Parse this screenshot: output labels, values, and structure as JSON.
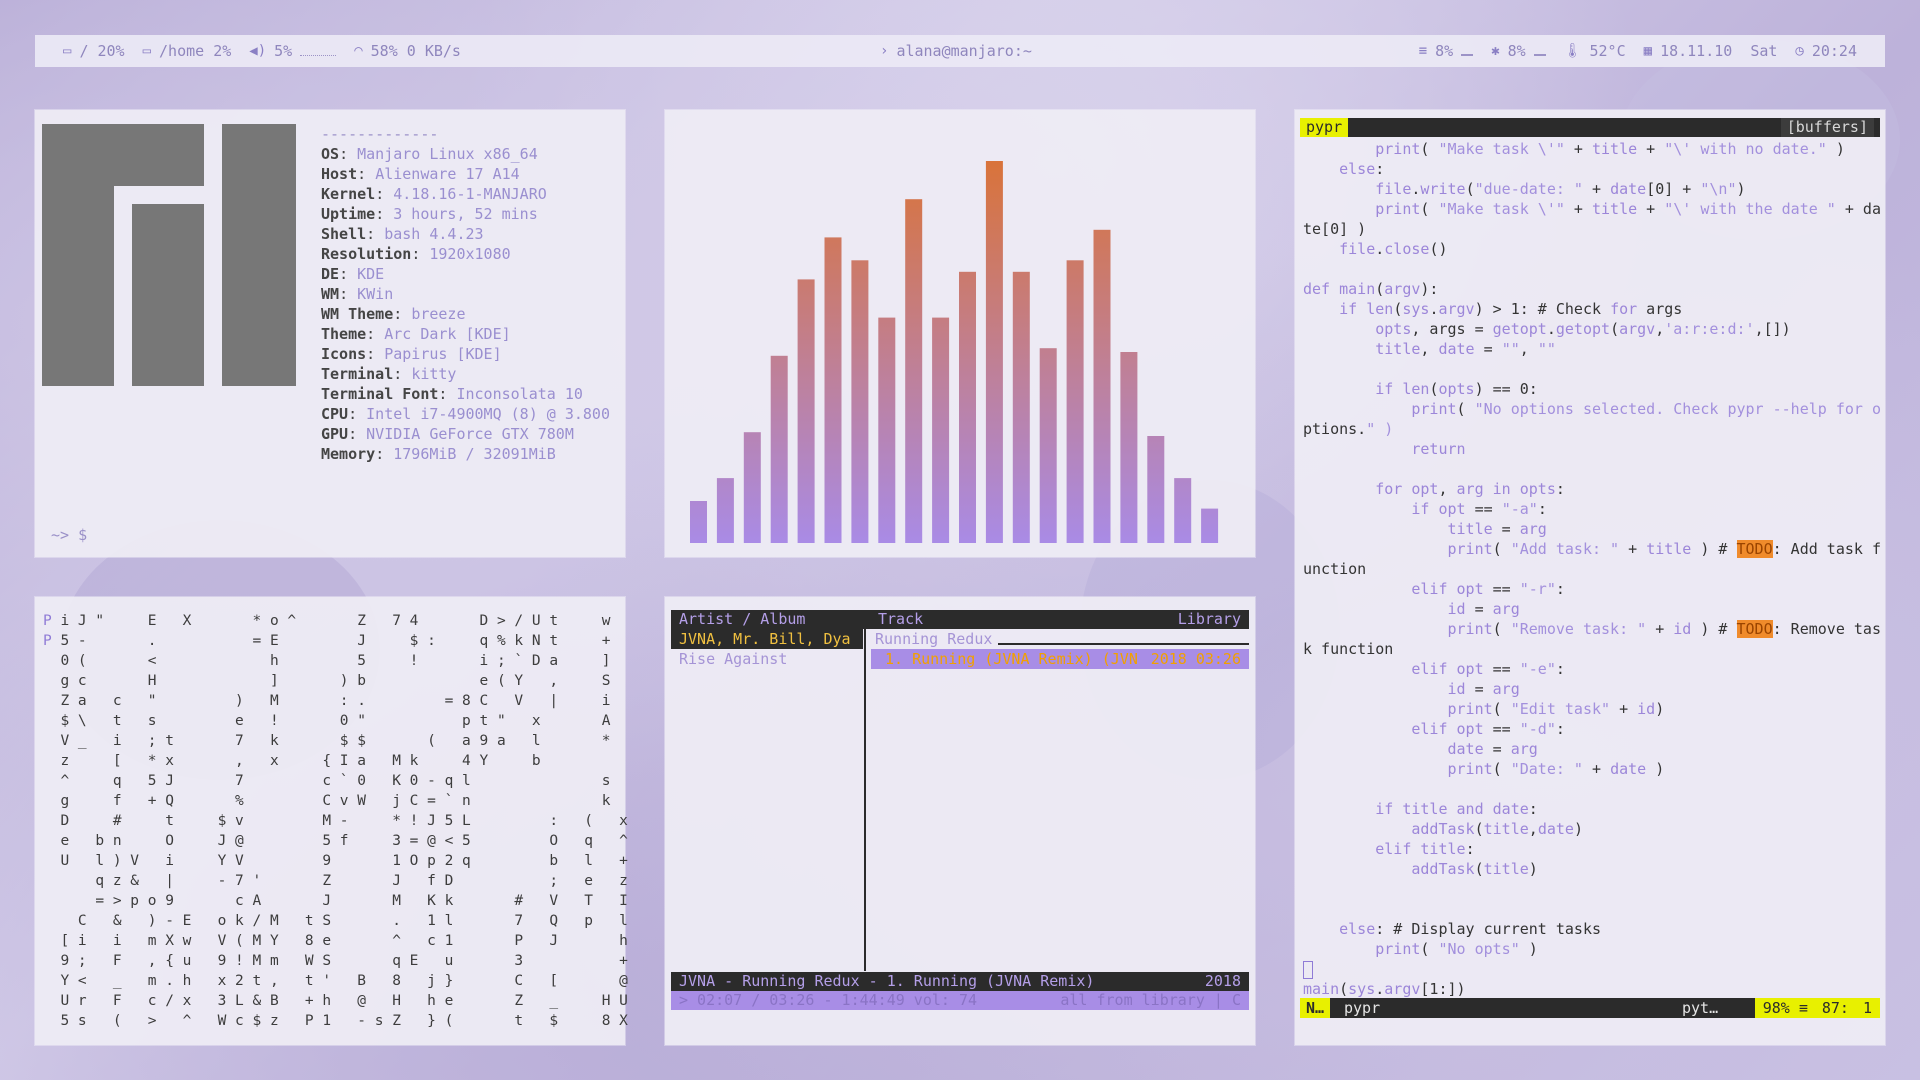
{
  "topbar": {
    "disk_root": "/ 20%",
    "disk_home": "/home 2%",
    "volume": "5%",
    "wifi": "58% 0 KB/s",
    "title": "alana@manjaro:~",
    "cpu": "8%",
    "mem": "8%",
    "temp": "52°C",
    "date": "18.11.10",
    "day": "Sat",
    "time": "20:24"
  },
  "neofetch": {
    "separator": "-------------",
    "fields": [
      {
        "k": "OS",
        "v": "Manjaro Linux x86_64"
      },
      {
        "k": "Host",
        "v": "Alienware 17 A14"
      },
      {
        "k": "Kernel",
        "v": "4.18.16-1-MANJARO"
      },
      {
        "k": "Uptime",
        "v": "3 hours, 52 mins"
      },
      {
        "k": "Shell",
        "v": "bash 4.4.23"
      },
      {
        "k": "Resolution",
        "v": "1920x1080"
      },
      {
        "k": "DE",
        "v": "KDE"
      },
      {
        "k": "WM",
        "v": "KWin"
      },
      {
        "k": "WM Theme",
        "v": "breeze"
      },
      {
        "k": "Theme",
        "v": "Arc Dark [KDE]"
      },
      {
        "k": "Icons",
        "v": "Papirus [KDE]"
      },
      {
        "k": "Terminal",
        "v": "kitty"
      },
      {
        "k": "Terminal Font",
        "v": "Inconsolata 10"
      },
      {
        "k": "CPU",
        "v": "Intel i7-4900MQ (8) @ 3.800"
      },
      {
        "k": "GPU",
        "v": "NVIDIA GeForce GTX 780M"
      },
      {
        "k": "Memory",
        "v": "1796MiB / 32091MiB"
      }
    ],
    "prompt": "~> $"
  },
  "visualizer": {
    "levels": [
      0.11,
      0.17,
      0.29,
      0.49,
      0.69,
      0.8,
      0.74,
      0.59,
      0.9,
      0.59,
      0.71,
      1.0,
      0.71,
      0.51,
      0.74,
      0.82,
      0.5,
      0.28,
      0.17,
      0.09
    ],
    "color_top": "#d9733a",
    "color_bottom": "#a98be6"
  },
  "editor": {
    "buffer_name": "pypr",
    "buffers_label": "[buffers]",
    "lines": [
      "        print( \"Make task \\'\" + title + \"\\' with no date.\" )",
      "    else:",
      "        file.write(\"due-date: \" + date[0] + \"\\n\")",
      "        print( \"Make task \\'\" + title + \"\\' with the date \" + da",
      "te[0] )",
      "    file.close()",
      "",
      "def main(argv):",
      "    if len(sys.argv) > 1: # Check for args",
      "        opts, args = getopt.getopt(argv,'a:r:e:d:',[])",
      "        title, date = \"\", \"\"",
      "",
      "        if len(opts) == 0:",
      "            print( \"No options selected. Check pypr --help for o",
      "ptions.\" )",
      "            return",
      "",
      "        for opt, arg in opts:",
      "            if opt == \"-a\":",
      "                title = arg",
      "                print( \"Add task: \" + title ) # TODO: Add task f",
      "unction",
      "            elif opt == \"-r\":",
      "                id = arg",
      "                print( \"Remove task: \" + id ) # TODO: Remove tas",
      "k function",
      "            elif opt == \"-e\":",
      "                id = arg",
      "                print( \"Edit task\" + id)",
      "            elif opt == \"-d\":",
      "                date = arg",
      "                print( \"Date: \" + date )",
      "",
      "        if title and date:",
      "            addTask(title,date)",
      "        elif title:",
      "            addTask(title)",
      "",
      "",
      "    else: # Display current tasks",
      "        print( \"No opts\" )",
      "",
      "main(sys.argv[1:])"
    ],
    "status_mode": "N…",
    "status_file": "pypr",
    "status_filetype": "pyt…",
    "status_percent": "98% ≡",
    "status_line": "87:",
    "status_col": "1"
  },
  "matrix": {
    "rows": [
      "P i J \"     E   X       * o ^       Z   7 4       D > / U t     w",
      "P 5 -       .           = E         J     $ :     q % k N t     +",
      "  0 (       <             h         5     !       i ; ` D a     ]",
      "  g c       H             ]       ) b             e ( Y   ,     S",
      "  Z a   c   \"         )   M       : .         = 8 C   V   |     i",
      "  $ \\   t   s         e   !       0 \"           p t \"   x       A",
      "  V _   i   ; t       7   k       $ $       (   a 9 a   l       *",
      "  z     [   * x       ,   x     { I a   M k     4 Y     b",
      "  ^     q   5 J       7         c ` 0   K 0 - q l               s",
      "  g     f   + Q       %         C v W   j C = ` n               k",
      "  D     #     t     $ v         M -     * ! J 5 L         :   (   x",
      "  e   b n     O     J @         5 f     3 = @ < 5         O   q   ^",
      "  U   l ) V   i     Y V         9       1 O p 2 q         b   l   +",
      "      q z &   |     - 7 '       Z       J   f D           ;   e   z",
      "      = > p o 9       c A       J       M   K k       #   V   T   I",
      "    C   &   ) - E   o k / M   t S       .   1 l       7   Q   p   l",
      "  [ i   i   m X w   V ( M Y   8 e       ^   c 1       P   J       h",
      "  9 ;   F   , { u   9 ! M m   W S       q E   u       3           +",
      "  Y <   _   m . h   x 2 t ,   t '   B   8   j }       C   [       @",
      "  U r   F   c / x   3 L & B   + h   @   H   h e       Z   _     H U",
      "  5 s   (   >   ^   W c $ z   P 1   - s Z   } (       t   $     8 X"
    ]
  },
  "music": {
    "header_artist": "Artist / Album",
    "header_track": "Track",
    "header_library": "Library",
    "artists": [
      "JVNA, Mr. Bill, Dya",
      "Rise Against"
    ],
    "album": "Running Redux",
    "track_title": "1. Running (JVNA Remix) (JVN",
    "track_year_time": "2018 03:26",
    "status_now": "JVNA - Running Redux -  1. Running (JVNA Remix)",
    "status_year": "2018",
    "status_progress": "> 02:07 / 03:26 - 1:44:49 vol: 74",
    "status_mode": "all from library | C"
  }
}
